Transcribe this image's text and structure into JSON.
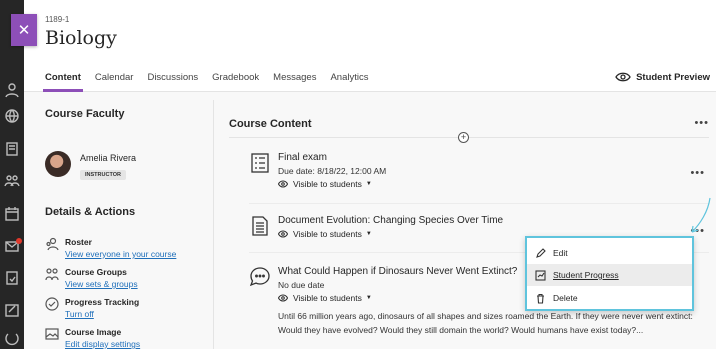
{
  "course": {
    "id": "1189-1",
    "title": "Biology"
  },
  "tabs": [
    "Content",
    "Calendar",
    "Discussions",
    "Gradebook",
    "Messages",
    "Analytics"
  ],
  "student_preview": "Student Preview",
  "left": {
    "faculty_title": "Course Faculty",
    "faculty_name": "Amelia Rivera",
    "faculty_role": "INSTRUCTOR",
    "details_title": "Details & Actions",
    "actions": [
      {
        "title": "Roster",
        "link": "View everyone in your course",
        "icon": "roster-icon"
      },
      {
        "title": "Course Groups",
        "link": "View sets & groups",
        "icon": "groups-icon"
      },
      {
        "title": "Progress Tracking",
        "link": "Turn off",
        "icon": "progress-check-icon"
      },
      {
        "title": "Course Image",
        "link": "Edit display settings",
        "icon": "image-icon"
      }
    ]
  },
  "content": {
    "title": "Course Content",
    "items": [
      {
        "title": "Final exam",
        "sub": "Due date: 8/18/22, 12:00 AM",
        "visibility": "Visible to students"
      },
      {
        "title": "Document Evolution: Changing Species Over Time",
        "visibility": "Visible to students"
      },
      {
        "title": "What Could Happen if Dinosaurs Never Went Extinct?",
        "sub": "No due date",
        "visibility": "Visible to students",
        "desc": "Until 66 million years ago, dinosaurs of all shapes and sizes roamed the Earth. If they were never went extinct: Would they have evolved? Would they still domain the world? Would humans have exist today?..."
      }
    ]
  },
  "menu": {
    "items": [
      "Edit",
      "Student Progress",
      "Delete"
    ]
  },
  "colors": {
    "accent": "#8d4fb8",
    "link": "#1f6fba",
    "menu_border": "#5fc4dd"
  }
}
